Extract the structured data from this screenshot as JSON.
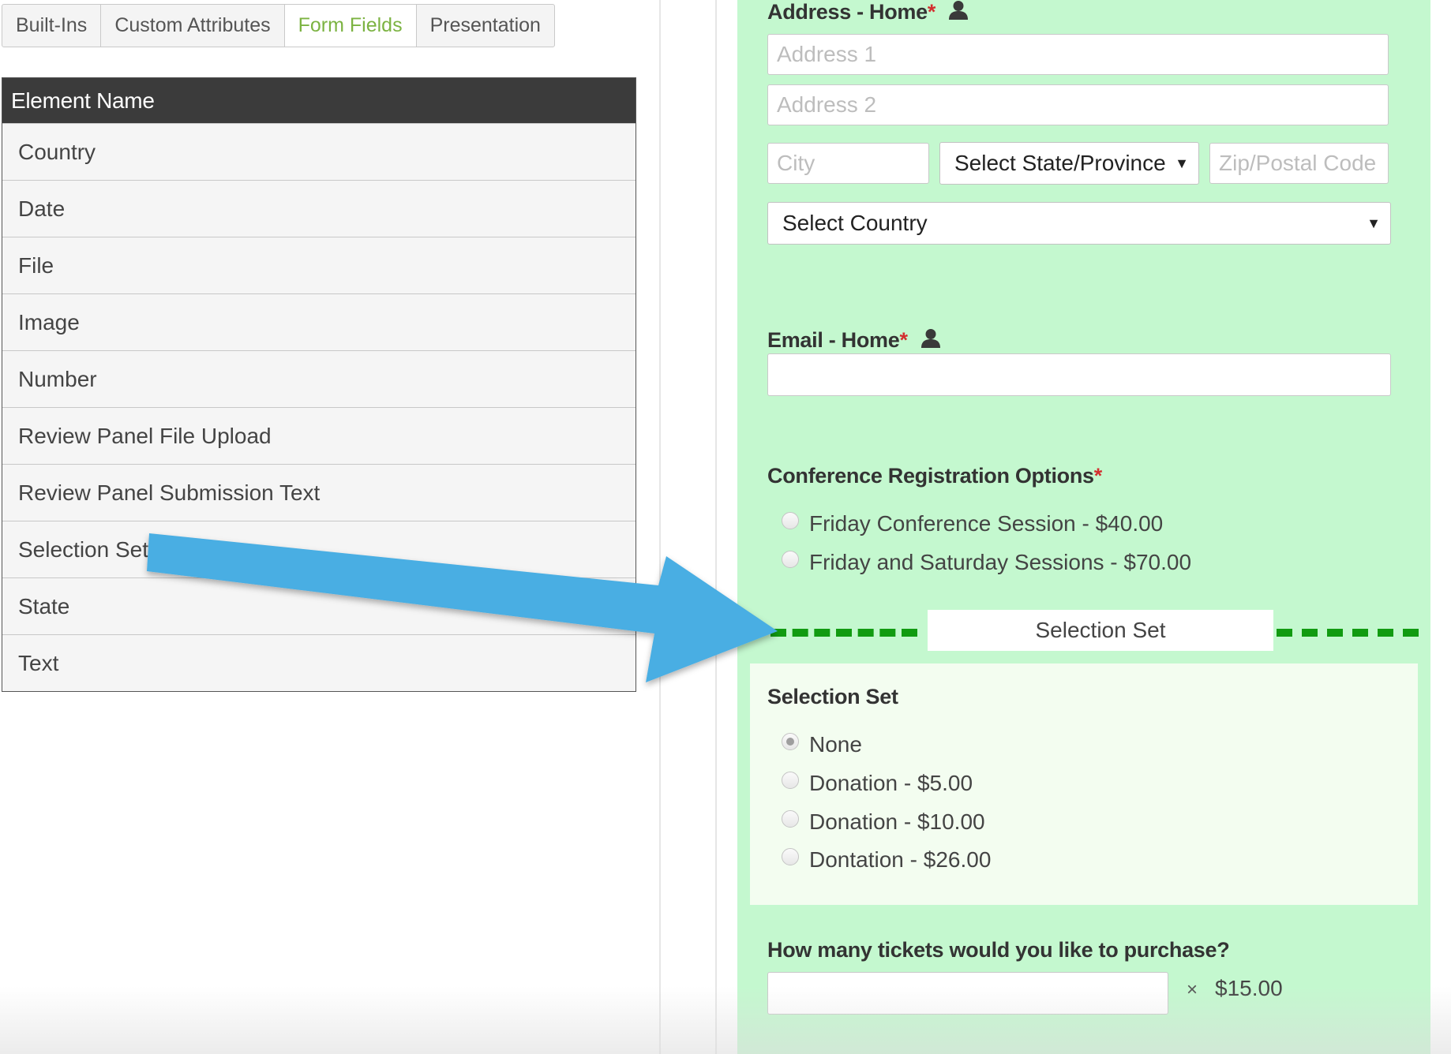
{
  "tabs": [
    "Built-Ins",
    "Custom Attributes",
    "Form Fields",
    "Presentation"
  ],
  "active_tab": "Form Fields",
  "elements_table": {
    "header": "Element Name",
    "rows": [
      "Country",
      "Date",
      "File",
      "Image",
      "Number",
      "Review Panel File Upload",
      "Review Panel Submission Text",
      "Selection Set",
      "State",
      "Text"
    ]
  },
  "form": {
    "address": {
      "label": "Address - Home",
      "required_mark": "*",
      "address1_placeholder": "Address 1",
      "address2_placeholder": "Address 2",
      "city_placeholder": "City",
      "state_select": "Select State/Province",
      "zip_placeholder": "Zip/Postal Code",
      "country_select": "Select Country"
    },
    "email": {
      "label": "Email - Home",
      "required_mark": "*",
      "value": ""
    },
    "conference": {
      "label": "Conference Registration Options",
      "required_mark": "*",
      "options": [
        "Friday Conference Session - $40.00",
        "Friday and Saturday Sessions - $70.00"
      ]
    },
    "drop_indicator": "Selection Set",
    "selection_set": {
      "label": "Selection Set",
      "options": [
        "None",
        "Donation - $5.00",
        "Donation - $10.00",
        "Dontation - $26.00"
      ],
      "selected": "None"
    },
    "tickets": {
      "label": "How many tickets would you like to purchase?",
      "value": "",
      "multiplier": "×",
      "price": "$15.00"
    }
  },
  "colors": {
    "form_bg": "#c4f8cf",
    "active_tab": "#7cb342",
    "drop_line": "#119b11",
    "arrow": "#4aaee3",
    "required": "#d32f2f"
  },
  "icons": {
    "field_owner": "person-icon",
    "select_caret": "caret-down-icon",
    "drag_arrow": "arrow-icon"
  }
}
